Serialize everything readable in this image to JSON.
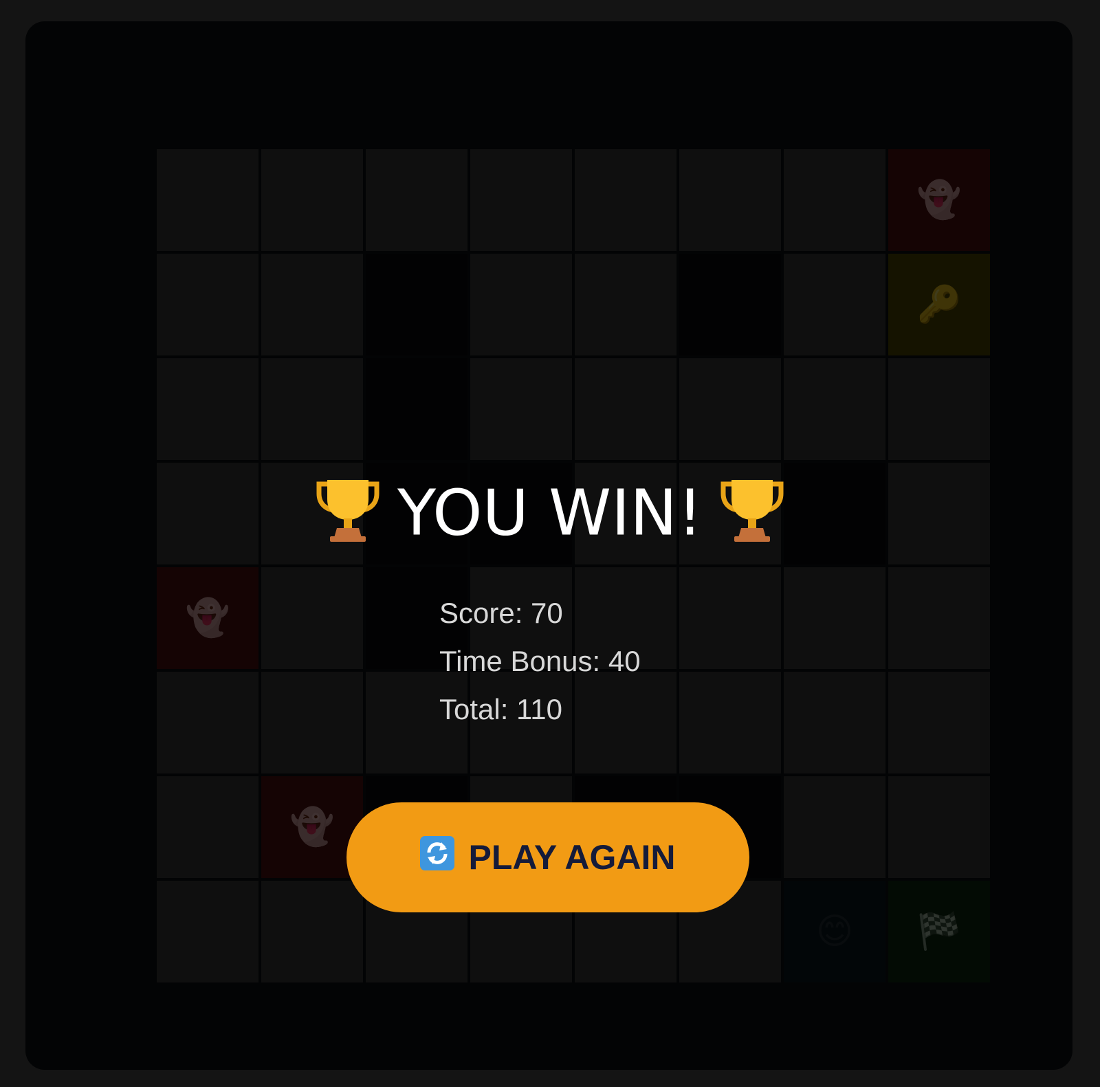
{
  "board": {
    "rows": [
      [
        {
          "t": "floor",
          "icon": ""
        },
        {
          "t": "floor",
          "icon": ""
        },
        {
          "t": "floor",
          "icon": ""
        },
        {
          "t": "floor",
          "icon": ""
        },
        {
          "t": "floor",
          "icon": ""
        },
        {
          "t": "floor",
          "icon": ""
        },
        {
          "t": "floor",
          "icon": ""
        },
        {
          "t": "ghost",
          "icon": "👻"
        }
      ],
      [
        {
          "t": "floor",
          "icon": ""
        },
        {
          "t": "floor",
          "icon": ""
        },
        {
          "t": "wall",
          "icon": ""
        },
        {
          "t": "floor",
          "icon": ""
        },
        {
          "t": "floor",
          "icon": ""
        },
        {
          "t": "wall",
          "icon": ""
        },
        {
          "t": "floor",
          "icon": ""
        },
        {
          "t": "key",
          "icon": "🔑"
        }
      ],
      [
        {
          "t": "floor",
          "icon": ""
        },
        {
          "t": "floor",
          "icon": ""
        },
        {
          "t": "wall",
          "icon": ""
        },
        {
          "t": "floor",
          "icon": ""
        },
        {
          "t": "floor",
          "icon": ""
        },
        {
          "t": "floor",
          "icon": ""
        },
        {
          "t": "floor",
          "icon": ""
        },
        {
          "t": "floor",
          "icon": ""
        }
      ],
      [
        {
          "t": "floor",
          "icon": ""
        },
        {
          "t": "floor",
          "icon": ""
        },
        {
          "t": "wall",
          "icon": ""
        },
        {
          "t": "wall",
          "icon": ""
        },
        {
          "t": "floor",
          "icon": ""
        },
        {
          "t": "floor",
          "icon": ""
        },
        {
          "t": "wall",
          "icon": ""
        },
        {
          "t": "floor",
          "icon": ""
        }
      ],
      [
        {
          "t": "ghost",
          "icon": "👻"
        },
        {
          "t": "floor",
          "icon": ""
        },
        {
          "t": "wall",
          "icon": ""
        },
        {
          "t": "floor",
          "icon": ""
        },
        {
          "t": "floor",
          "icon": ""
        },
        {
          "t": "floor",
          "icon": ""
        },
        {
          "t": "floor",
          "icon": ""
        },
        {
          "t": "floor",
          "icon": ""
        }
      ],
      [
        {
          "t": "floor",
          "icon": ""
        },
        {
          "t": "floor",
          "icon": ""
        },
        {
          "t": "floor",
          "icon": ""
        },
        {
          "t": "floor",
          "icon": ""
        },
        {
          "t": "floor",
          "icon": ""
        },
        {
          "t": "floor",
          "icon": ""
        },
        {
          "t": "floor",
          "icon": ""
        },
        {
          "t": "floor",
          "icon": ""
        }
      ],
      [
        {
          "t": "floor",
          "icon": ""
        },
        {
          "t": "ghost",
          "icon": "👻"
        },
        {
          "t": "wall",
          "icon": ""
        },
        {
          "t": "floor",
          "icon": ""
        },
        {
          "t": "wall",
          "icon": ""
        },
        {
          "t": "wall",
          "icon": ""
        },
        {
          "t": "floor",
          "icon": ""
        },
        {
          "t": "floor",
          "icon": ""
        }
      ],
      [
        {
          "t": "floor",
          "icon": ""
        },
        {
          "t": "floor",
          "icon": ""
        },
        {
          "t": "floor",
          "icon": ""
        },
        {
          "t": "floor",
          "icon": ""
        },
        {
          "t": "floor",
          "icon": ""
        },
        {
          "t": "floor",
          "icon": ""
        },
        {
          "t": "player",
          "icon": "😊"
        },
        {
          "t": "goal",
          "icon": "🏁"
        }
      ]
    ]
  },
  "overlay": {
    "title": "YOU WIN!",
    "title_icon": "trophy-icon",
    "score_line": "Score: 70",
    "time_bonus_line": "Time Bonus: 40",
    "total_line": "Total: 110",
    "play_again_label": "PLAY AGAIN",
    "play_again_icon": "refresh-icon"
  },
  "colors": {
    "page_background": "#141414",
    "panel_background": "#030405",
    "button_background": "#f29b14",
    "button_text": "#151b3a",
    "title_text": "#ffffff",
    "stats_text": "#d8d8d8"
  }
}
